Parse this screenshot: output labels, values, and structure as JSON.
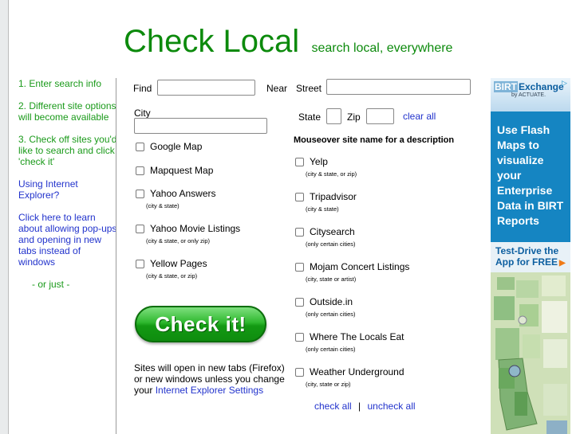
{
  "header": {
    "title": "Check Local",
    "tagline": "search local, everywhere"
  },
  "steps": {
    "step1": "1. Enter search info",
    "step2": "2. Different site options will become available",
    "step3": "3. Check off sites you'd like to search and click 'check it'",
    "ie_question": "Using Internet Explorer?",
    "popups_link": "Click here to learn about allowing pop-ups and opening in new tabs instead of windows",
    "or_just": "- or just -"
  },
  "form": {
    "find_label": "Find",
    "near_label": "Near",
    "city_label": "City",
    "street_label": "Street",
    "state_label": "State",
    "zip_label": "Zip",
    "clear_all": "clear all",
    "find_value": "",
    "street_value": "",
    "city_value": "",
    "state_value": "",
    "zip_value": ""
  },
  "left_sites": [
    {
      "label": "Google Map",
      "note": ""
    },
    {
      "label": "Mapquest Map",
      "note": ""
    },
    {
      "label": "Yahoo Answers",
      "note": "(city & state)"
    },
    {
      "label": "Yahoo Movie Listings",
      "note": "(city & state, or only zip)"
    },
    {
      "label": "Yellow Pages",
      "note": "(city & state, or zip)"
    }
  ],
  "mouseover_hint": "Mouseover site name for a description",
  "right_sites": [
    {
      "label": "Yelp",
      "note": "(city & state, or zip)"
    },
    {
      "label": "Tripadvisor",
      "note": "(city & state)"
    },
    {
      "label": "Citysearch",
      "note": "(only certain cities)"
    },
    {
      "label": "Mojam Concert Listings",
      "note": "(city, state or artist)"
    },
    {
      "label": "Outside.in",
      "note": "(only certain cities)"
    },
    {
      "label": "Where The Locals Eat",
      "note": "(only certain cities)"
    },
    {
      "label": "Weather Underground",
      "note": "(city, state or zip)"
    }
  ],
  "check_button": "Check it!",
  "open_info": {
    "text": "Sites will open in new tabs (Firefox) or new windows unless you change your",
    "link": "Internet Explorer Settings"
  },
  "bottom_links": {
    "check_all": "check all",
    "separator": "|",
    "uncheck_all": "uncheck all"
  },
  "ad": {
    "brand_prefix": "BIRT",
    "brand_suffix": "Exchange",
    "by_line": "by ACTUATE.",
    "message": "Use Flash Maps to visualize your Enterprise Data in BIRT Reports",
    "cta": "Test-Drive the App for FREE",
    "colors": {
      "panel": "#1585c2",
      "brand_text": "#0d5fa0",
      "cta_arrow": "#f07a17"
    }
  },
  "colors": {
    "green": "#0c8a0c",
    "link": "#2233cc"
  }
}
